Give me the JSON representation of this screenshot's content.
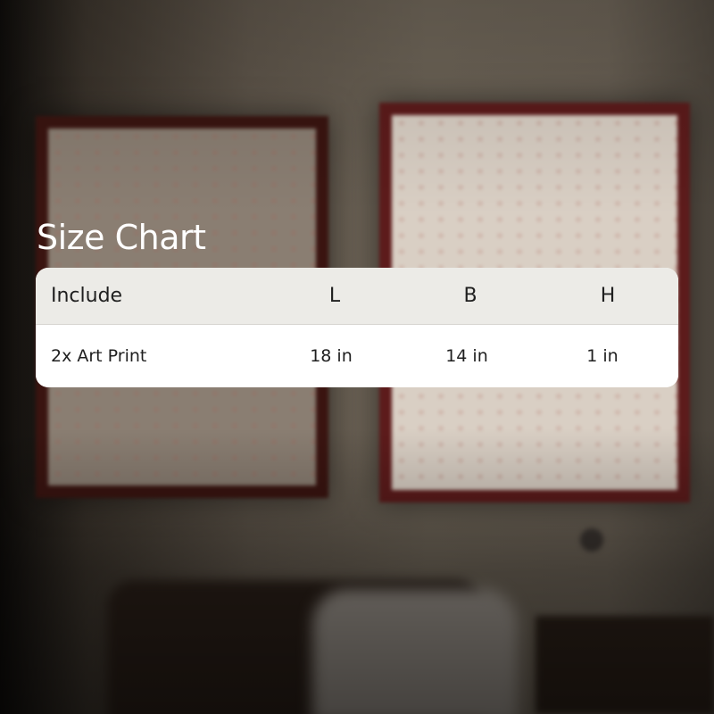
{
  "title": "Size Chart",
  "table": {
    "headers": [
      "Include",
      "L",
      "B",
      "H"
    ],
    "rows": [
      [
        "2x Art Print",
        "18 in",
        "14 in",
        "1 in"
      ]
    ]
  },
  "colors": {
    "title_text": "#ffffff",
    "header_bg": "#ecebe7",
    "row_bg": "#ffffff",
    "frame": "#5d1b1b"
  }
}
